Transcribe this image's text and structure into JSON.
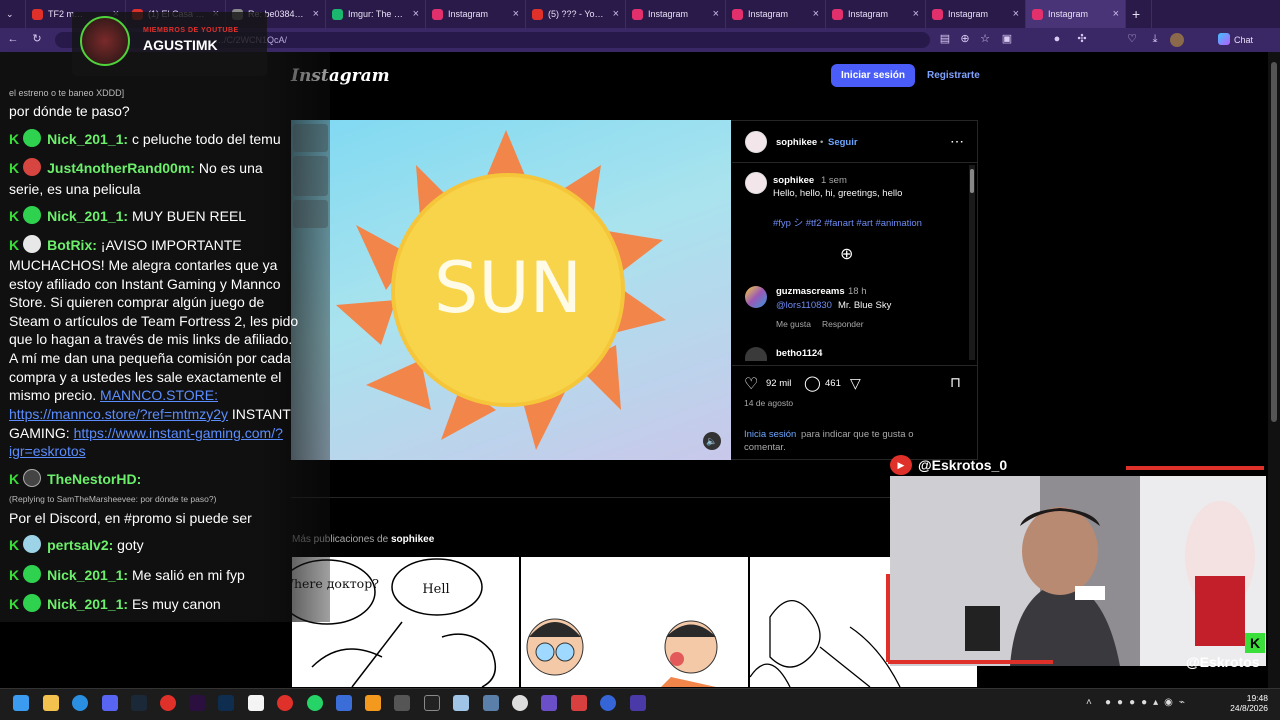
{
  "browser": {
    "tabs": [
      {
        "title": "TF2 m…",
        "icon_color": "#e0302a",
        "active": false
      },
      {
        "title": "(1) El Casa Submar…",
        "icon_color": "#e0302a",
        "active": false
      },
      {
        "title": "Re: be03845211e…",
        "icon_color": "#8a8a8a",
        "active": false
      },
      {
        "title": "Imgur: The magic",
        "icon_color": "#1bb76e",
        "active": false
      },
      {
        "title": "Instagram",
        "icon_color": "#e1306c",
        "active": false
      },
      {
        "title": "(5) ??? - YouTube",
        "icon_color": "#e0302a",
        "active": false
      },
      {
        "title": "Instagram",
        "icon_color": "#e1306c",
        "active": false
      },
      {
        "title": "Instagram",
        "icon_color": "#e1306c",
        "active": false
      },
      {
        "title": "Instagram",
        "icon_color": "#e1306c",
        "active": false
      },
      {
        "title": "Instagram",
        "icon_color": "#e1306c",
        "active": false
      },
      {
        "title": "Instagram",
        "icon_color": "#e1306c",
        "active": true
      }
    ],
    "new_tab": "+",
    "url": "…/C/2WCN1QcA/",
    "chat_button": "Chat"
  },
  "instagram": {
    "logo": "Instagram",
    "login_button": "Iniciar sesión",
    "signup_link": "Registrarte",
    "video_text": "SUN",
    "author": "sophikee",
    "follow": "Seguir",
    "caption_user": "sophikee",
    "caption_time": "1 sem",
    "caption_text": "Hello, hello, hi, greetings, hello",
    "hashtags": "#fyp シ #tf2 #fanart #art #animation",
    "comment_user": "guzmascreams",
    "comment_time": "18 h",
    "comment_mention": "@lors110830",
    "comment_text": "Mr. Blue Sky",
    "comment_like": "Me gusta",
    "comment_reply": "Responder",
    "comment2_user": "betho1124",
    "likes": "92 mil",
    "comments": "461",
    "date": "14 de agosto",
    "login_prompt_link": "Inicia sesión",
    "login_prompt_text": "para indicar que te gusta o",
    "login_prompt_text2": "comentar.",
    "more_label": "Más publicaciones de",
    "more_user": "sophikee",
    "comic_bubble1": "Where доктор?",
    "comic_bubble2": "Hell"
  },
  "stream": {
    "badge_caption": "MIEMBROS DE YOUTUBE",
    "badge_name": "AGUSTIMK",
    "handle_top": "@Eskrotos_0",
    "handle_bottom": "@Eskrotos",
    "chat": {
      "line0": "el estreno o te baneo XDDD]",
      "line1": "por dónde te paso?",
      "m1_name": "Nick_201_1:",
      "m1_text": "c peluche todo del temu",
      "m2_name": "Just4notherRand00m:",
      "m2_text": "No es una",
      "m2_text2": "serie, es una pelicula",
      "m3_name": "Nick_201_1:",
      "m3_text": "MUY BUEN REEL",
      "m4_name": "BotRix:",
      "m4_text": "¡AVISO IMPORTANTE",
      "m4_lines": [
        "MUCHACHOS! Me alegra contarles que ya",
        "estoy afiliado con Instant Gaming y Mannco",
        "Store. Si quieren comprar algún juego de",
        "Steam o artículos de Team Fortress 2, les pido",
        "que lo hagan a través de mis links de afiliado.",
        "A mí me dan una pequeña comisión por cada",
        "compra y a ustedes les sale exactamente el"
      ],
      "m4_pre": "mismo precio.",
      "m4_link1": "MANNCO.STORE:",
      "m4_link2": "https://mannco.store/?ref=mtmzy2y",
      "m4_mid": "INSTANT",
      "m4_mid2": "GAMING:",
      "m4_link3": "https://www.instant-gaming.com/?",
      "m4_link4": "igr=eskrotos",
      "m5_name": "TheNestorHD:",
      "m5_reply": "(Replying to SamTheMarsheevee: por dónde te paso?)",
      "m5_text": "Por el Discord, en #promo si puede ser",
      "m6_name": "pertsalv2:",
      "m6_text": "goty",
      "m7_name": "Nick_201_1:",
      "m7_text": "Me salió en mi fyp",
      "m8_name": "Nick_201_1:",
      "m8_text": "Es muy canon"
    }
  },
  "taskbar": {
    "time": "19:48",
    "date": "24/8/2026"
  }
}
